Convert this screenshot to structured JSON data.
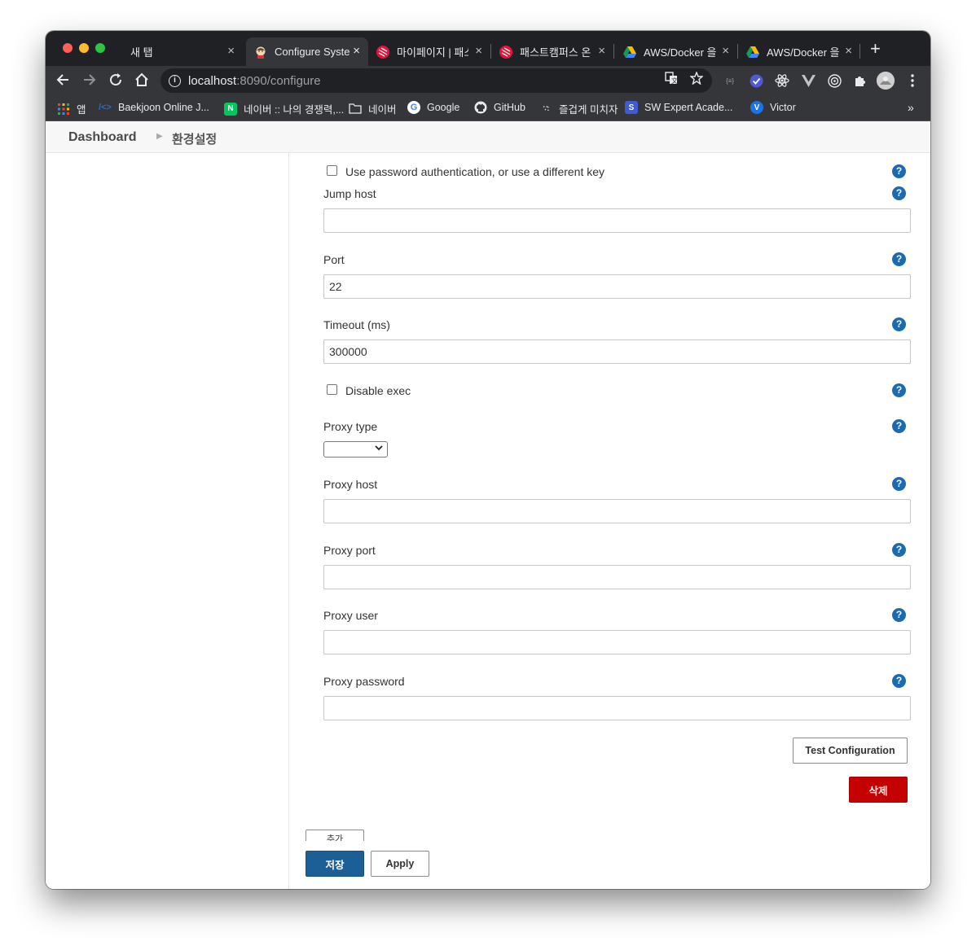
{
  "browser": {
    "tabs": [
      {
        "title": "새 탭",
        "active": false
      },
      {
        "title": "Configure Syste",
        "active": true
      },
      {
        "title": "마이페이지 | 패스트",
        "active": false
      },
      {
        "title": "패스트캠퍼스 온라",
        "active": false
      },
      {
        "title": "AWS/Docker 을",
        "active": false
      },
      {
        "title": "AWS/Docker 을",
        "active": false
      }
    ],
    "url_host": "localhost",
    "url_path": ":8090/configure",
    "bookmarks": [
      {
        "label": "앱",
        "icon": "apps-icon"
      },
      {
        "label": "Baekjoon Online J...",
        "icon": "code-icon"
      },
      {
        "label": "네이버 :: 나의 경쟁력,...",
        "icon": "naver-icon"
      },
      {
        "label": "네이버",
        "icon": "folder-icon"
      },
      {
        "label": "Google",
        "icon": "google-icon"
      },
      {
        "label": "GitHub",
        "icon": "github-icon"
      },
      {
        "label": "즐겁게 미치자",
        "icon": "dots-icon"
      },
      {
        "label": "SW Expert Acade...",
        "icon": "swea-icon"
      },
      {
        "label": "Victor",
        "icon": "victor-icon"
      }
    ],
    "overflow": "»"
  },
  "breadcrumb": {
    "root": "Dashboard",
    "current": "환경설정"
  },
  "form": {
    "use_password_label": "Use password authentication, or use a different key",
    "jump_host_label": "Jump host",
    "jump_host_value": "",
    "port_label": "Port",
    "port_value": "22",
    "timeout_label": "Timeout (ms)",
    "timeout_value": "300000",
    "disable_exec_label": "Disable exec",
    "proxy_type_label": "Proxy type",
    "proxy_type_value": "",
    "proxy_host_label": "Proxy host",
    "proxy_port_label": "Proxy port",
    "proxy_user_label": "Proxy user",
    "proxy_password_label": "Proxy password",
    "help_glyph": "?"
  },
  "buttons": {
    "test_configuration": "Test Configuration",
    "delete": "삭제",
    "add": "추가",
    "save": "저장",
    "apply": "Apply"
  },
  "colors": {
    "help": "#1c6bb0",
    "delete": "#c40000",
    "save": "#1c5f96"
  }
}
